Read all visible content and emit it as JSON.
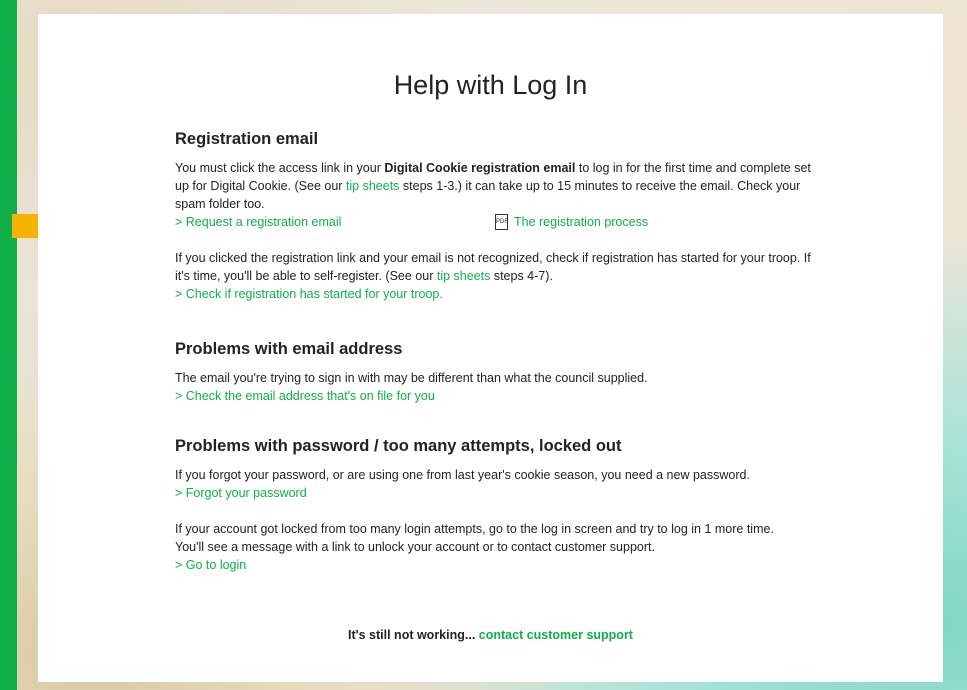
{
  "title": "Help with Log In",
  "registration": {
    "heading": "Registration email",
    "para1_a": "You must click the access link in your ",
    "para1_bold": "Digital Cookie registration email",
    "para1_b": " to log in for the first time and complete set up for Digital Cookie. (See our ",
    "para1_link": "tip sheets",
    "para1_c": " steps 1-3.) it can take up to 15 minutes to receive the email. Check your spam folder too.",
    "request_link": "> Request a registration email",
    "process_link": "The registration process",
    "para2_a": "If you clicked the registration link and your email is not recognized, check if registration has started for your troop. If it's time, you'll be able to self-register. (See our ",
    "para2_link": "tip sheets",
    "para2_b": " steps 4-7).",
    "check_link": "> Check if registration has started for your troop."
  },
  "email_problems": {
    "heading": "Problems with email address",
    "para": "The email you're trying to sign in with may be different than what the council supplied.",
    "link": "> Check the email address that's on file for you"
  },
  "password_problems": {
    "heading": "Problems with password / too many attempts, locked out",
    "para1": "If you forgot your password, or are using one from last year's cookie season, you need a new password.",
    "forgot_link": "> Forgot your password",
    "para2": "If your account got locked from too many login attempts, go to the log in screen and try to log in 1 more time. You'll see a message with a link to unlock your account or to contact customer support.",
    "login_link": "> Go to login"
  },
  "footer": {
    "text": "It's still not working... ",
    "link": "contact customer support"
  },
  "colors": {
    "accent_green": "#0fae49",
    "arrow_yellow": "#f5b301"
  },
  "icons": {
    "pdf": "pdf-file-icon",
    "arrow": "right-arrow-icon"
  }
}
